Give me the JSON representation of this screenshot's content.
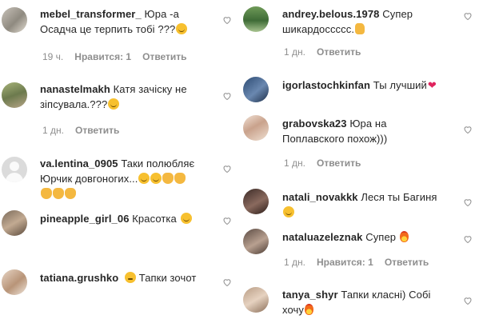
{
  "left_comments": [
    {
      "username": "mebel_transformer_",
      "lines": [
        "Юра -а",
        "Осадча це терпить тобі ???"
      ],
      "emojis": [
        "smile"
      ],
      "time": "19 ч.",
      "likes": "Нравится: 1",
      "reply": "Ответить",
      "avatar": "furniture-photo"
    },
    {
      "username": "nanastelmakh",
      "lines": [
        "Катя зачіску не",
        "зіпсувала.???"
      ],
      "emojis": [
        "smile"
      ],
      "time": "1 дн.",
      "likes": "",
      "reply": "Ответить",
      "avatar": "outdoor-photo"
    },
    {
      "username": "va.lentina_0905",
      "lines": [
        "Таки полюбляє",
        "Юрчик довгоногих..."
      ],
      "emojis": [
        "smile",
        "smile",
        "clap",
        "clap",
        "clap",
        "clap",
        "clap"
      ],
      "time": "",
      "likes": "",
      "reply": "",
      "avatar": "default"
    },
    {
      "username": "pineapple_girl_06",
      "lines": [
        "Красотка"
      ],
      "emojis": [
        "smile"
      ],
      "time": "",
      "likes": "",
      "reply": "",
      "avatar": "person-photo"
    },
    {
      "username": "tatiana.grushko",
      "lines": [
        "Тапки зочот"
      ],
      "emojis": [
        "neutral"
      ],
      "time": "",
      "likes": "",
      "reply": "",
      "avatar": "person-photo"
    }
  ],
  "right_comments": [
    {
      "username": "andrey.belous.1978",
      "lines": [
        "Супер",
        "шикардоссссс."
      ],
      "time": "1 дн.",
      "likes": "",
      "reply": "Ответить",
      "avatar": "person-photo"
    },
    {
      "username": "igorlastochkinfan",
      "lines": [
        "Ты лучший"
      ],
      "time": "",
      "likes": "",
      "reply": "",
      "avatar": "person-photo"
    },
    {
      "username": "grabovska23",
      "lines": [
        "Юра на",
        "Поплавского похож)))"
      ],
      "time": "1 дн.",
      "likes": "",
      "reply": "Ответить",
      "avatar": "person-photo"
    },
    {
      "username": "natali_novakkk",
      "lines": [
        "Леся ты Багиня"
      ],
      "time": "",
      "likes": "",
      "reply": "",
      "avatar": "person-photo"
    },
    {
      "username": "nataluazeleznak",
      "lines": [
        "Супер"
      ],
      "time": "1 дн.",
      "likes": "Нравится: 1",
      "reply": "Ответить",
      "avatar": "person-photo"
    },
    {
      "username": "tanya_shyr",
      "lines": [
        "Тапки класні) Собі",
        "хочу"
      ],
      "time": "",
      "likes": "",
      "reply": "",
      "avatar": "person-photo"
    }
  ],
  "colors": {
    "text": "#262626",
    "meta": "#8e8e8e",
    "heart_outline": "#8e8e8e"
  }
}
